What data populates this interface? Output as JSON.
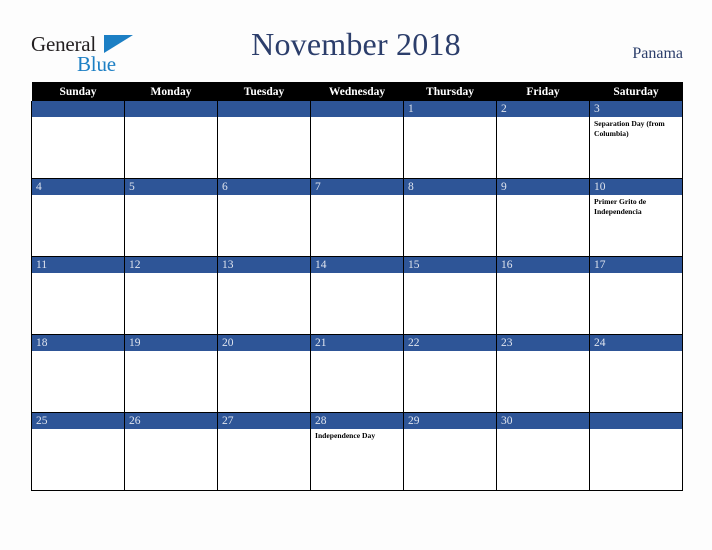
{
  "branding": {
    "logo_primary": "General",
    "logo_secondary": "Blue",
    "logo_accent_color": "#1c7fc4",
    "logo_text_color": "#231f20"
  },
  "header": {
    "title": "November 2018",
    "country": "Panama",
    "title_color": "#2c3e6b"
  },
  "theme": {
    "date_bar_color": "#2e5597",
    "weekday_header_bg": "#000000",
    "weekday_header_text": "#ffffff",
    "cell_bg": "#ffffff",
    "page_bg": "#fdfdfd",
    "grid_line_color": "#000000"
  },
  "calendar": {
    "weekdays": [
      "Sunday",
      "Monday",
      "Tuesday",
      "Wednesday",
      "Thursday",
      "Friday",
      "Saturday"
    ],
    "weeks": [
      [
        {
          "date": "",
          "holiday": ""
        },
        {
          "date": "",
          "holiday": ""
        },
        {
          "date": "",
          "holiday": ""
        },
        {
          "date": "",
          "holiday": ""
        },
        {
          "date": "1",
          "holiday": ""
        },
        {
          "date": "2",
          "holiday": ""
        },
        {
          "date": "3",
          "holiday": "Separation Day (from Columbia)"
        }
      ],
      [
        {
          "date": "4",
          "holiday": ""
        },
        {
          "date": "5",
          "holiday": ""
        },
        {
          "date": "6",
          "holiday": ""
        },
        {
          "date": "7",
          "holiday": ""
        },
        {
          "date": "8",
          "holiday": ""
        },
        {
          "date": "9",
          "holiday": ""
        },
        {
          "date": "10",
          "holiday": "Primer Grito de Independencia"
        }
      ],
      [
        {
          "date": "11",
          "holiday": ""
        },
        {
          "date": "12",
          "holiday": ""
        },
        {
          "date": "13",
          "holiday": ""
        },
        {
          "date": "14",
          "holiday": ""
        },
        {
          "date": "15",
          "holiday": ""
        },
        {
          "date": "16",
          "holiday": ""
        },
        {
          "date": "17",
          "holiday": ""
        }
      ],
      [
        {
          "date": "18",
          "holiday": ""
        },
        {
          "date": "19",
          "holiday": ""
        },
        {
          "date": "20",
          "holiday": ""
        },
        {
          "date": "21",
          "holiday": ""
        },
        {
          "date": "22",
          "holiday": ""
        },
        {
          "date": "23",
          "holiday": ""
        },
        {
          "date": "24",
          "holiday": ""
        }
      ],
      [
        {
          "date": "25",
          "holiday": ""
        },
        {
          "date": "26",
          "holiday": ""
        },
        {
          "date": "27",
          "holiday": ""
        },
        {
          "date": "28",
          "holiday": "Independence Day"
        },
        {
          "date": "29",
          "holiday": ""
        },
        {
          "date": "30",
          "holiday": ""
        },
        {
          "date": "",
          "holiday": ""
        }
      ]
    ]
  }
}
